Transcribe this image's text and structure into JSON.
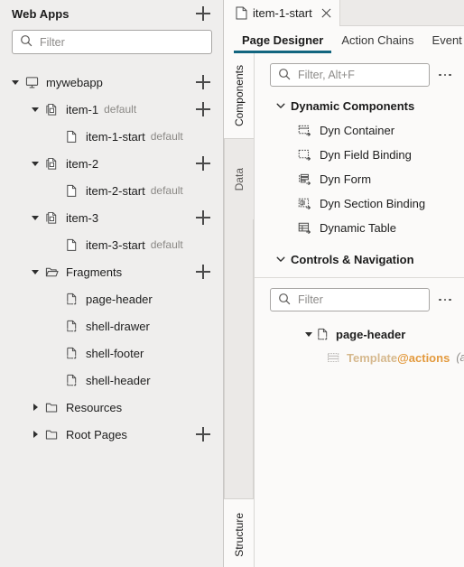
{
  "left_panel": {
    "title": "Web Apps",
    "add_label": "+",
    "filter": {
      "placeholder": "Filter",
      "value": "",
      "icon": "search-icon"
    },
    "tree": [
      {
        "label": "mywebapp",
        "badge": "",
        "icon": "monitor-icon",
        "twisty": "down",
        "indent": 0,
        "add": true
      },
      {
        "label": "item-1",
        "badge": "default",
        "icon": "pages-icon",
        "twisty": "down",
        "indent": 1,
        "add": true
      },
      {
        "label": "item-1-start",
        "badge": "default",
        "icon": "page-icon",
        "twisty": "none",
        "indent": 2,
        "add": false
      },
      {
        "label": "item-2",
        "badge": "",
        "icon": "pages-icon",
        "twisty": "down",
        "indent": 1,
        "add": true
      },
      {
        "label": "item-2-start",
        "badge": "default",
        "icon": "page-icon",
        "twisty": "none",
        "indent": 2,
        "add": false
      },
      {
        "label": "item-3",
        "badge": "",
        "icon": "pages-icon",
        "twisty": "down",
        "indent": 1,
        "add": true
      },
      {
        "label": "item-3-start",
        "badge": "default",
        "icon": "page-icon",
        "twisty": "none",
        "indent": 2,
        "add": false
      },
      {
        "label": "Fragments",
        "badge": "",
        "icon": "folder-open-icon",
        "twisty": "down",
        "indent": 1,
        "add": true
      },
      {
        "label": "page-header",
        "badge": "",
        "icon": "fragment-icon",
        "twisty": "none",
        "indent": 2,
        "add": false
      },
      {
        "label": "shell-drawer",
        "badge": "",
        "icon": "fragment-icon",
        "twisty": "none",
        "indent": 2,
        "add": false
      },
      {
        "label": "shell-footer",
        "badge": "",
        "icon": "fragment-icon",
        "twisty": "none",
        "indent": 2,
        "add": false
      },
      {
        "label": "shell-header",
        "badge": "",
        "icon": "fragment-icon",
        "twisty": "none",
        "indent": 2,
        "add": false
      },
      {
        "label": "Resources",
        "badge": "",
        "icon": "folder-icon",
        "twisty": "right",
        "indent": 1,
        "add": false
      },
      {
        "label": "Root Pages",
        "badge": "",
        "icon": "folder-icon",
        "twisty": "right",
        "indent": 1,
        "add": true
      }
    ]
  },
  "editor": {
    "document_tab": {
      "label": "item-1-start",
      "icon": "page-icon",
      "close_icon": "close-icon"
    },
    "subtabs": [
      {
        "label": "Page Designer",
        "active": true
      },
      {
        "label": "Action Chains",
        "active": false
      },
      {
        "label": "Event Li",
        "active": false
      }
    ],
    "vertical_tabs": [
      {
        "label": "Components",
        "active": true
      },
      {
        "label": "Data",
        "active": false
      },
      {
        "label": "Structure",
        "active": false
      }
    ],
    "components_panel": {
      "filter": {
        "placeholder": "Filter, Alt+F",
        "value": "",
        "icon": "search-icon"
      },
      "menu_icon": "kebab-menu-icon",
      "groups": [
        {
          "title": "Dynamic Components",
          "expanded": true,
          "items": [
            {
              "label": "Dyn Container",
              "icon": "dyn-container-icon"
            },
            {
              "label": "Dyn Field Binding",
              "icon": "dyn-field-binding-icon"
            },
            {
              "label": "Dyn Form",
              "icon": "dyn-form-icon"
            },
            {
              "label": "Dyn Section Binding",
              "icon": "dyn-section-binding-icon"
            },
            {
              "label": "Dynamic Table",
              "icon": "dynamic-table-icon"
            }
          ]
        },
        {
          "title": "Controls & Navigation",
          "expanded": true,
          "items": []
        }
      ]
    },
    "structure_panel": {
      "filter": {
        "placeholder": "Filter",
        "value": "",
        "icon": "search-icon"
      },
      "menu_icon": "kebab-menu-icon",
      "nodes": [
        {
          "label": "page-header",
          "icon": "fragment-icon",
          "twisty": "down",
          "level": 0,
          "suffix": "",
          "note": ""
        },
        {
          "label": "Template",
          "icon": "template-icon",
          "twisty": "none",
          "level": 1,
          "suffix": "@actions",
          "note": "(actions)"
        }
      ]
    }
  },
  "colors": {
    "accent": "#12657f",
    "panel_bg": "#efeeed",
    "content_bg": "#fbfaf9",
    "template_text": "#d6b98e",
    "at_actions": "#e39a3e"
  }
}
